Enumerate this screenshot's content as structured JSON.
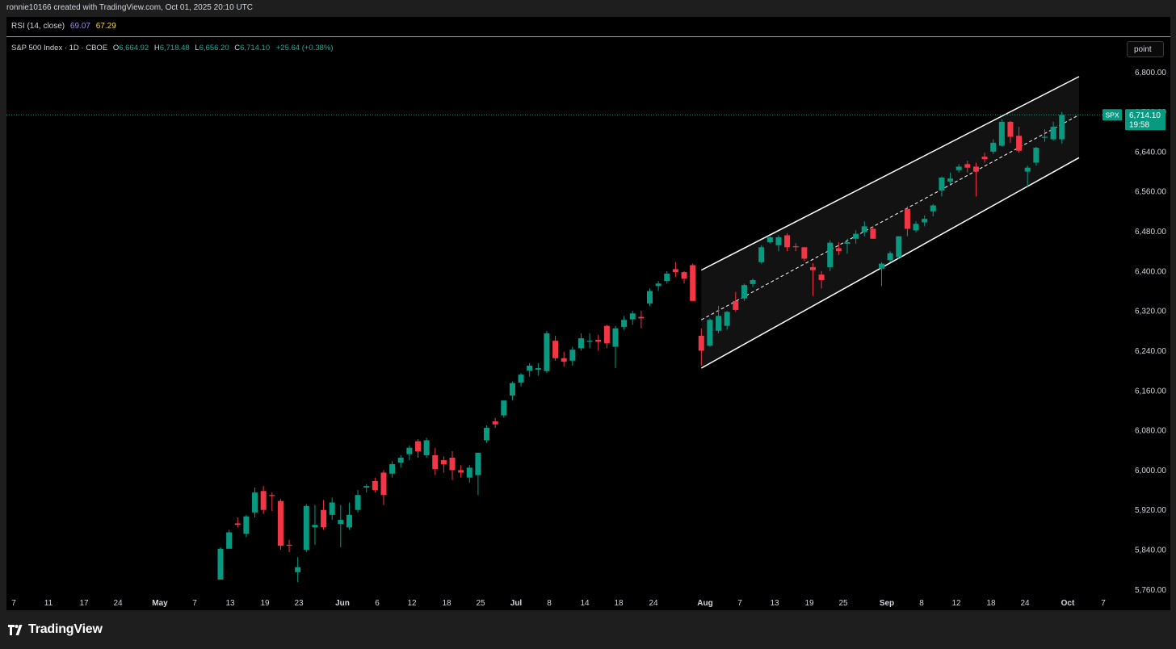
{
  "caption": "ronnie10166 created with TradingView.com, Oct 01, 2025 20:10 UTC",
  "rsi": {
    "label": "RSI (14, close)",
    "value1": "69.07",
    "value2": "67.29"
  },
  "legend": {
    "title": "S&P 500 Index · 1D · CBOE",
    "o_label": "O",
    "o_value": "6,664.92",
    "h_label": "H",
    "h_value": "6,718.48",
    "l_label": "L",
    "l_value": "6,656.20",
    "c_label": "C",
    "c_value": "6,714.10",
    "change": "+25.64 (+0.38%)"
  },
  "point_button": "point",
  "price_tag": {
    "symbol": "SPX",
    "price": "6,714.10",
    "countdown": "19:58"
  },
  "brand": "TradingView",
  "colors": {
    "up": "#089981",
    "down": "#f23645",
    "channel_line": "#ffffff",
    "background": "#000000"
  },
  "chart_data": {
    "type": "candlestick",
    "ticker": "SPX",
    "interval": "1D",
    "ylim": [
      5720,
      6880
    ],
    "y_ticks": [
      "6,800.00",
      "6,720.00",
      "6,640.00",
      "6,560.00",
      "6,480.00",
      "6,400.00",
      "6,320.00",
      "6,240.00",
      "6,160.00",
      "6,080.00",
      "6,000.00",
      "5,920.00",
      "5,840.00",
      "5,760.00"
    ],
    "y_tick_values": [
      6800,
      6720,
      6640,
      6560,
      6480,
      6400,
      6320,
      6240,
      6160,
      6080,
      6000,
      5920,
      5840,
      5760
    ],
    "x_ticks": [
      {
        "label": "7",
        "bold": false
      },
      {
        "label": "11",
        "bold": false
      },
      {
        "label": "17",
        "bold": false
      },
      {
        "label": "24",
        "bold": false
      },
      {
        "label": "May",
        "bold": true
      },
      {
        "label": "7",
        "bold": false
      },
      {
        "label": "13",
        "bold": false
      },
      {
        "label": "19",
        "bold": false
      },
      {
        "label": "23",
        "bold": false
      },
      {
        "label": "Jun",
        "bold": true
      },
      {
        "label": "6",
        "bold": false
      },
      {
        "label": "12",
        "bold": false
      },
      {
        "label": "18",
        "bold": false
      },
      {
        "label": "25",
        "bold": false
      },
      {
        "label": "Jul",
        "bold": true
      },
      {
        "label": "8",
        "bold": false
      },
      {
        "label": "14",
        "bold": false
      },
      {
        "label": "18",
        "bold": false
      },
      {
        "label": "24",
        "bold": false
      },
      {
        "label": "Aug",
        "bold": true
      },
      {
        "label": "7",
        "bold": false
      },
      {
        "label": "13",
        "bold": false
      },
      {
        "label": "19",
        "bold": false
      },
      {
        "label": "25",
        "bold": false
      },
      {
        "label": "Sep",
        "bold": true
      },
      {
        "label": "8",
        "bold": false
      },
      {
        "label": "12",
        "bold": false
      },
      {
        "label": "18",
        "bold": false
      },
      {
        "label": "24",
        "bold": false
      },
      {
        "label": "Oct",
        "bold": true
      },
      {
        "label": "7",
        "bold": false
      }
    ],
    "first_candle": "May 12",
    "candles": [
      [
        5780,
        5845,
        5795,
        5842
      ],
      [
        5842,
        5880,
        5850,
        5875
      ],
      [
        5893,
        5905,
        5885,
        5890
      ],
      [
        5872,
        5910,
        5865,
        5907
      ],
      [
        5915,
        5965,
        5905,
        5955
      ],
      [
        5958,
        5968,
        5912,
        5920
      ],
      [
        5950,
        5955,
        5918,
        5948
      ],
      [
        5938,
        5942,
        5840,
        5848
      ],
      [
        5850,
        5860,
        5835,
        5848
      ],
      [
        5795,
        5825,
        5775,
        5805
      ],
      [
        5840,
        5932,
        5835,
        5928
      ],
      [
        5885,
        5930,
        5850,
        5890
      ],
      [
        5920,
        5940,
        5880,
        5885
      ],
      [
        5910,
        5945,
        5900,
        5935
      ],
      [
        5892,
        5930,
        5845,
        5900
      ],
      [
        5885,
        5935,
        5880,
        5910
      ],
      [
        5920,
        5960,
        5915,
        5950
      ],
      [
        5965,
        5972,
        5955,
        5968
      ],
      [
        5978,
        5985,
        5955,
        5960
      ],
      [
        5995,
        6000,
        5930,
        5950
      ],
      [
        5993,
        6018,
        5985,
        6012
      ],
      [
        6015,
        6030,
        6005,
        6025
      ],
      [
        6032,
        6050,
        6020,
        6045
      ],
      [
        6058,
        6062,
        6025,
        6038
      ],
      [
        6030,
        6065,
        6025,
        6060
      ],
      [
        6030,
        6045,
        5990,
        6002
      ],
      [
        6020,
        6028,
        5995,
        6012
      ],
      [
        6025,
        6038,
        5980,
        6000
      ],
      [
        6000,
        6010,
        5985,
        5995
      ],
      [
        5985,
        6010,
        5975,
        6005
      ],
      [
        5990,
        6035,
        5950,
        6035
      ],
      [
        6060,
        6090,
        6055,
        6085
      ],
      [
        6098,
        6105,
        6085,
        6092
      ],
      [
        6110,
        6140,
        6105,
        6140
      ],
      [
        6150,
        6178,
        6140,
        6175
      ],
      [
        6176,
        6195,
        6168,
        6192
      ],
      [
        6200,
        6215,
        6188,
        6210
      ],
      [
        6202,
        6215,
        6190,
        6205
      ],
      [
        6199,
        6280,
        6195,
        6275
      ],
      [
        6260,
        6270,
        6220,
        6225
      ],
      [
        6225,
        6238,
        6208,
        6218
      ],
      [
        6220,
        6248,
        6210,
        6242
      ],
      [
        6245,
        6275,
        6240,
        6265
      ],
      [
        6258,
        6275,
        6245,
        6260
      ],
      [
        6262,
        6272,
        6240,
        6258
      ],
      [
        6290,
        6292,
        6245,
        6255
      ],
      [
        6248,
        6290,
        6205,
        6285
      ],
      [
        6288,
        6310,
        6282,
        6302
      ],
      [
        6303,
        6320,
        6292,
        6315
      ],
      [
        6308,
        6320,
        6285,
        6305
      ],
      [
        6335,
        6365,
        6330,
        6360
      ],
      [
        6370,
        6380,
        6360,
        6375
      ],
      [
        6380,
        6400,
        6375,
        6395
      ],
      [
        6404,
        6418,
        6388,
        6398
      ],
      [
        6398,
        6400,
        6375,
        6385
      ],
      [
        6412,
        6415,
        6340,
        6340
      ],
      [
        6270,
        6285,
        6210,
        6240
      ],
      [
        6250,
        6305,
        6248,
        6302
      ],
      [
        6280,
        6330,
        6275,
        6310
      ],
      [
        6290,
        6320,
        6282,
        6318
      ],
      [
        6340,
        6358,
        6318,
        6322
      ],
      [
        6345,
        6375,
        6340,
        6372
      ],
      [
        6374,
        6385,
        6368,
        6382
      ],
      [
        6418,
        6452,
        6415,
        6448
      ],
      [
        6458,
        6470,
        6455,
        6468
      ],
      [
        6452,
        6472,
        6440,
        6468
      ],
      [
        6472,
        6476,
        6440,
        6448
      ],
      [
        6450,
        6456,
        6440,
        6449
      ],
      [
        6448,
        6448,
        6420,
        6425
      ],
      [
        6408,
        6416,
        6350,
        6402
      ],
      [
        6393,
        6400,
        6365,
        6382
      ],
      [
        6408,
        6462,
        6400,
        6457
      ],
      [
        6446,
        6458,
        6432,
        6440
      ],
      [
        6455,
        6465,
        6435,
        6458
      ],
      [
        6465,
        6482,
        6455,
        6475
      ],
      [
        6478,
        6500,
        6470,
        6490
      ],
      [
        6485,
        6490,
        6465,
        6465
      ],
      [
        6405,
        6418,
        6370,
        6415
      ],
      [
        6422,
        6440,
        6418,
        6436
      ],
      [
        6428,
        6470,
        6425,
        6470
      ],
      [
        6525,
        6530,
        6470,
        6485
      ],
      [
        6482,
        6500,
        6478,
        6495
      ],
      [
        6498,
        6512,
        6490,
        6505
      ],
      [
        6520,
        6535,
        6510,
        6532
      ],
      [
        6562,
        6590,
        6550,
        6588
      ],
      [
        6580,
        6598,
        6575,
        6586
      ],
      [
        6603,
        6615,
        6598,
        6610
      ],
      [
        6615,
        6622,
        6598,
        6608
      ],
      [
        6610,
        6618,
        6550,
        6600
      ],
      [
        6630,
        6638,
        6618,
        6625
      ],
      [
        6640,
        6665,
        6635,
        6658
      ],
      [
        6652,
        6705,
        6650,
        6700
      ],
      [
        6700,
        6702,
        6658,
        6670
      ],
      [
        6672,
        6690,
        6638,
        6642
      ],
      [
        6600,
        6612,
        6570,
        6608
      ],
      [
        6618,
        6650,
        6612,
        6648
      ],
      [
        6668,
        6685,
        6660,
        6670
      ],
      [
        6665,
        6700,
        6662,
        6690
      ],
      [
        6665,
        6720,
        6656,
        6714
      ]
    ],
    "channel": {
      "upper": [
        [
          56,
          6402
        ],
        [
          100,
          6791
        ]
      ],
      "mid": [
        [
          56,
          6302
        ],
        [
          100,
          6714
        ]
      ],
      "lower": [
        [
          56,
          6205
        ],
        [
          100,
          6628
        ]
      ],
      "fill": true
    },
    "last_price": 6714.1
  }
}
